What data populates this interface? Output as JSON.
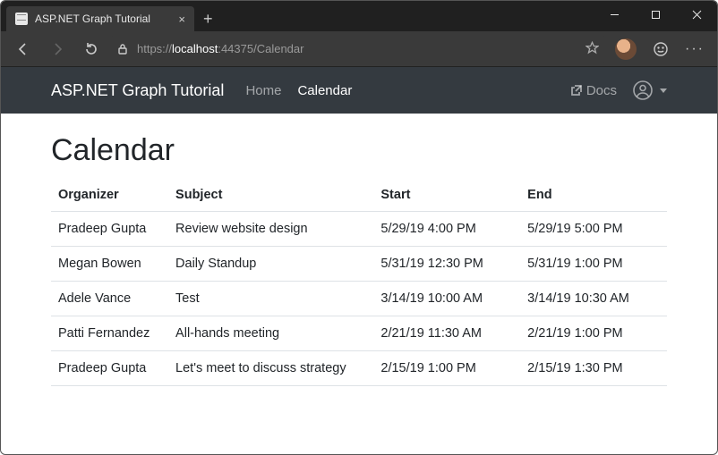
{
  "browser": {
    "tab_title": "ASP.NET Graph Tutorial",
    "url_scheme": "https://",
    "url_host": "localhost",
    "url_port_path": ":44375/Calendar"
  },
  "navbar": {
    "brand": "ASP.NET Graph Tutorial",
    "home_label": "Home",
    "calendar_label": "Calendar",
    "docs_label": "Docs"
  },
  "page": {
    "heading": "Calendar"
  },
  "table": {
    "headers": {
      "organizer": "Organizer",
      "subject": "Subject",
      "start": "Start",
      "end": "End"
    },
    "rows": [
      {
        "organizer": "Pradeep Gupta",
        "subject": "Review website design",
        "start": "5/29/19 4:00 PM",
        "end": "5/29/19 5:00 PM"
      },
      {
        "organizer": "Megan Bowen",
        "subject": "Daily Standup",
        "start": "5/31/19 12:30 PM",
        "end": "5/31/19 1:00 PM"
      },
      {
        "organizer": "Adele Vance",
        "subject": "Test",
        "start": "3/14/19 10:00 AM",
        "end": "3/14/19 10:30 AM"
      },
      {
        "organizer": "Patti Fernandez",
        "subject": "All-hands meeting",
        "start": "2/21/19 11:30 AM",
        "end": "2/21/19 1:00 PM"
      },
      {
        "organizer": "Pradeep Gupta",
        "subject": "Let's meet to discuss strategy",
        "start": "2/15/19 1:00 PM",
        "end": "2/15/19 1:30 PM"
      }
    ]
  }
}
